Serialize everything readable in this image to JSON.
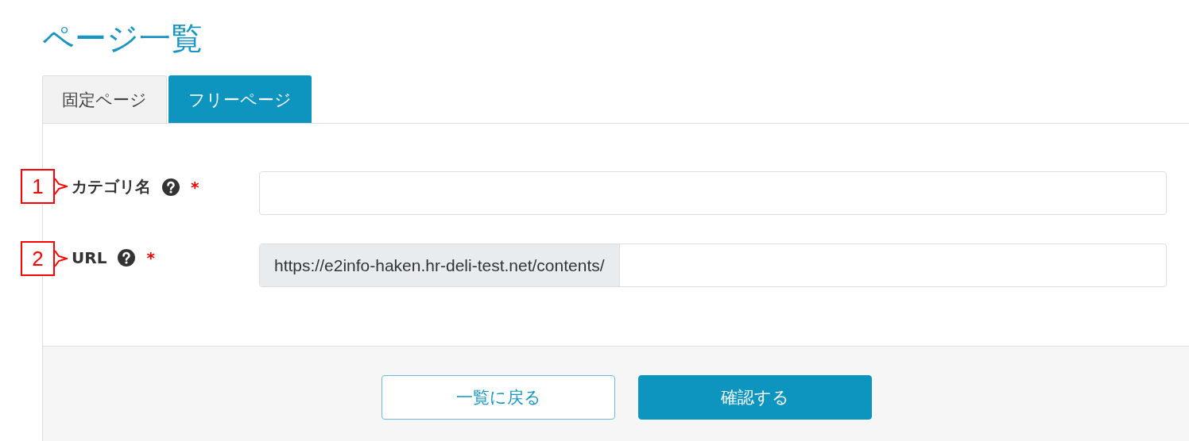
{
  "page_title": "ページ一覧",
  "tabs": [
    {
      "label": "固定ページ",
      "selected": false
    },
    {
      "label": "フリーページ",
      "selected": true
    }
  ],
  "fields": [
    {
      "callout": "1",
      "label": "カテゴリ名",
      "required_mark": "*"
    },
    {
      "callout": "2",
      "label": "URL",
      "required_mark": "*",
      "prefix": "https://e2info-haken.hr-deli-test.net/contents/"
    }
  ],
  "buttons": [
    {
      "label": "一覧に戻る",
      "kind": "secondary"
    },
    {
      "label": "確認する",
      "kind": "primary"
    }
  ]
}
